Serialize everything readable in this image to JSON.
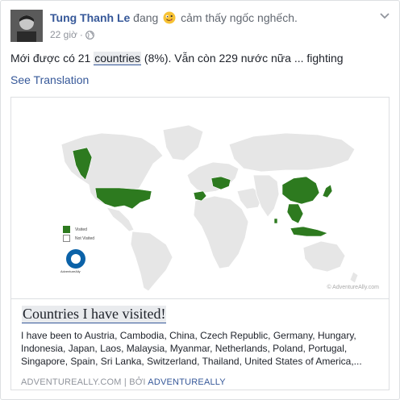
{
  "post": {
    "author": "Tung Thanh Le",
    "activity_verb": "đang",
    "feeling": "cảm thấy ngốc nghếch.",
    "emoji_icon": "silly-face-emoji",
    "time": "22 giờ",
    "dot": "·",
    "privacy_icon": "globe-icon",
    "text_before": "Mới được có 21 ",
    "text_highlight": "countries",
    "text_after": " (8%). Vẫn còn 229 nước nữa ... fighting",
    "see_translation": "See Translation"
  },
  "attachment": {
    "map_credit": "© AdventureAlly.com",
    "legend": {
      "visited": "Visited",
      "not_visited": "Not Visited"
    },
    "logo_text": "AdventureAlly",
    "title": "Countries I have visited!",
    "description": "I have been to Austria, Cambodia, China, Czech Republic, Germany, Hungary, Indonesia, Japan, Laos, Malaysia, Myanmar, Netherlands, Poland, Portugal, Singapore, Spain, Sri Lanka, Switzerland, Thailand, United States of America,...",
    "source_domain": "ADVENTUREALLY.COM",
    "source_sep": " | ",
    "source_by_label": "BỞI ",
    "source_by": "ADVENTUREALLY"
  },
  "colors": {
    "visited": "#2d7a1f",
    "not_visited": "#e6e6e6",
    "link": "#365899"
  }
}
